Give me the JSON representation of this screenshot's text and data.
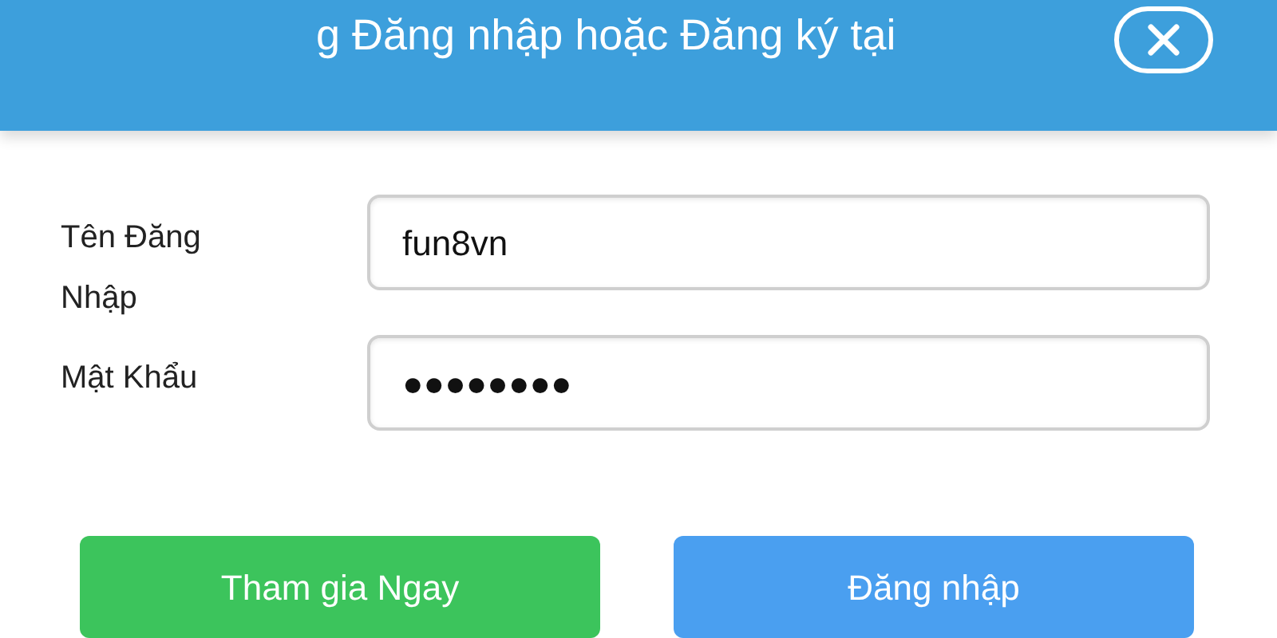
{
  "header": {
    "title": "g Đăng nhập hoặc Đăng ký tại"
  },
  "form": {
    "fields": [
      {
        "label": "Tên Đăng Nhập",
        "value": "fun8vn"
      },
      {
        "label": "Mật Khẩu",
        "value": "●●●●●●●●"
      }
    ]
  },
  "buttons": [
    {
      "label": "Tham gia Ngay",
      "kind": "register"
    },
    {
      "label": "Đăng nhập",
      "kind": "login"
    }
  ]
}
